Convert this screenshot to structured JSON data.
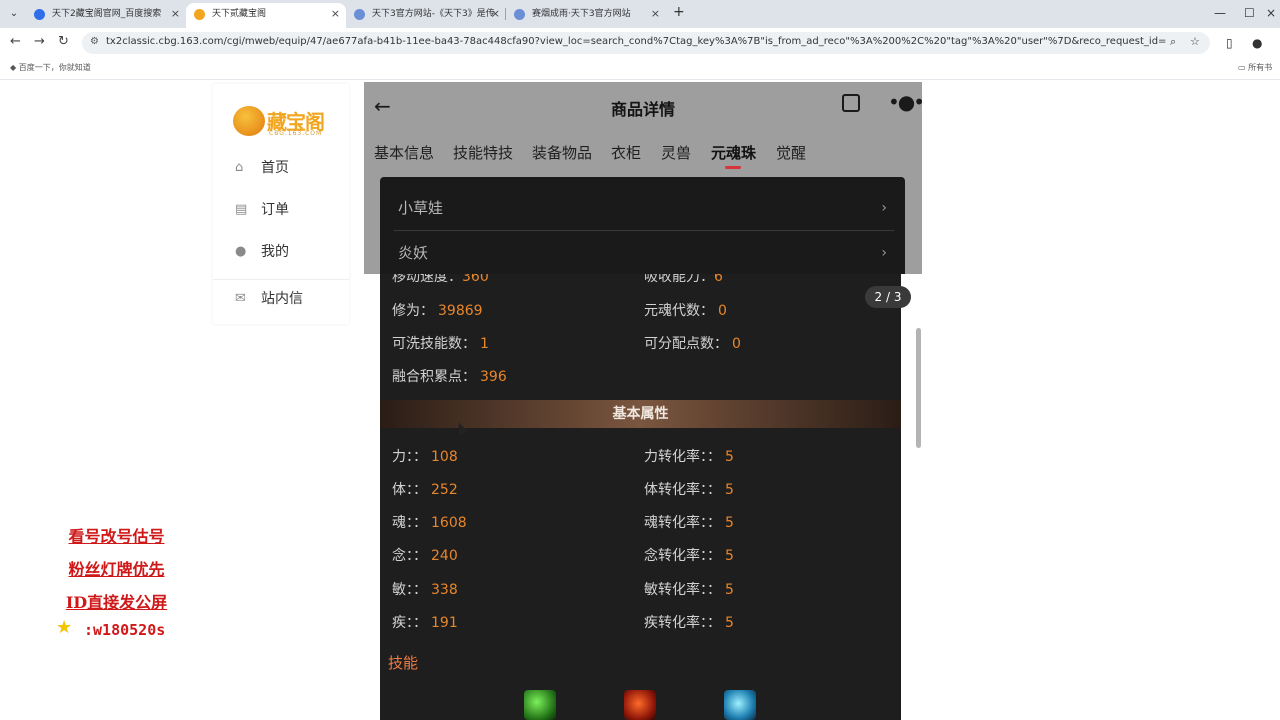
{
  "browser": {
    "tabs": [
      {
        "title": "天下2藏宝阁官网_百度搜索",
        "favicon_color": "#2f6ee8"
      },
      {
        "title": "天下贰藏宝阁",
        "favicon_color": "#f2a51e"
      },
      {
        "title": "天下3官方网站-《天下3》是传",
        "favicon_color": "#6a8fd6"
      },
      {
        "title": "赛烟成雨·天下3官方网站",
        "favicon_color": "#6a8fd6"
      }
    ],
    "url": "tx2classic.cbg.163.com/cgi/mweb/equip/47/ae677afa-b41b-11ee-ba43-78ac448cfa90?view_loc=search_cond%7Ctag_key%3A%7B\"is_from_ad_reco\"%3A%200%2C%20\"tag\"%3A%20\"user\"%7D&reco_request_id=1710338860757DNOII&ta...",
    "bookmark_left": "百度一下，你就知道",
    "bookmark_right": "所有书"
  },
  "sidebar": {
    "logo_text": "藏宝阁",
    "logo_sub": "CBG.163.COM",
    "items": [
      {
        "label": "首页",
        "icon": "home-icon"
      },
      {
        "label": "订单",
        "icon": "order-icon"
      },
      {
        "label": "我的",
        "icon": "user-icon"
      },
      {
        "label": "站内信",
        "icon": "mail-icon"
      }
    ]
  },
  "promo": {
    "lines": [
      "看号改号估号",
      "粉丝灯牌优先",
      "ID直接发公屏"
    ],
    "id": ":w180520s"
  },
  "panel": {
    "title": "商品详情",
    "tabs": [
      "基本信息",
      "技能特技",
      "装备物品",
      "衣柜",
      "灵兽",
      "元魂珠",
      "觉醒"
    ],
    "active_tab": "元魂珠",
    "dropdown": [
      "小草娃",
      "炎妖"
    ],
    "pager": "2 / 3",
    "clipped_left": {
      "label": "移动速度：",
      "value": "360"
    },
    "clipped_right": {
      "label": "吸收能力：",
      "value": "6"
    },
    "stats_top": [
      {
        "label": "修为：",
        "value": "39869"
      },
      {
        "label": "元魂代数：",
        "value": "0"
      },
      {
        "label": "可洗技能数：",
        "value": "1"
      },
      {
        "label": "可分配点数：",
        "value": "0"
      },
      {
        "label": "融合积累点：",
        "value": "396"
      }
    ],
    "section": "基本属性",
    "attrs": [
      {
        "label": "力：：",
        "value": "108",
        "rlabel": "力转化率：：",
        "rvalue": "5"
      },
      {
        "label": "体：：",
        "value": "252",
        "rlabel": "体转化率：：",
        "rvalue": "5"
      },
      {
        "label": "魂：：",
        "value": "1608",
        "rlabel": "魂转化率：：",
        "rvalue": "5"
      },
      {
        "label": "念：：",
        "value": "240",
        "rlabel": "念转化率：：",
        "rvalue": "5"
      },
      {
        "label": "敏：：",
        "value": "338",
        "rlabel": "敏转化率：：",
        "rvalue": "5"
      },
      {
        "label": "疾：：",
        "value": "191",
        "rlabel": "疾转化率：：",
        "rvalue": "5"
      }
    ],
    "skills_title": "技能",
    "skill_icons": [
      "green-skill-icon",
      "red-skill-icon",
      "blue-skill-icon"
    ]
  }
}
